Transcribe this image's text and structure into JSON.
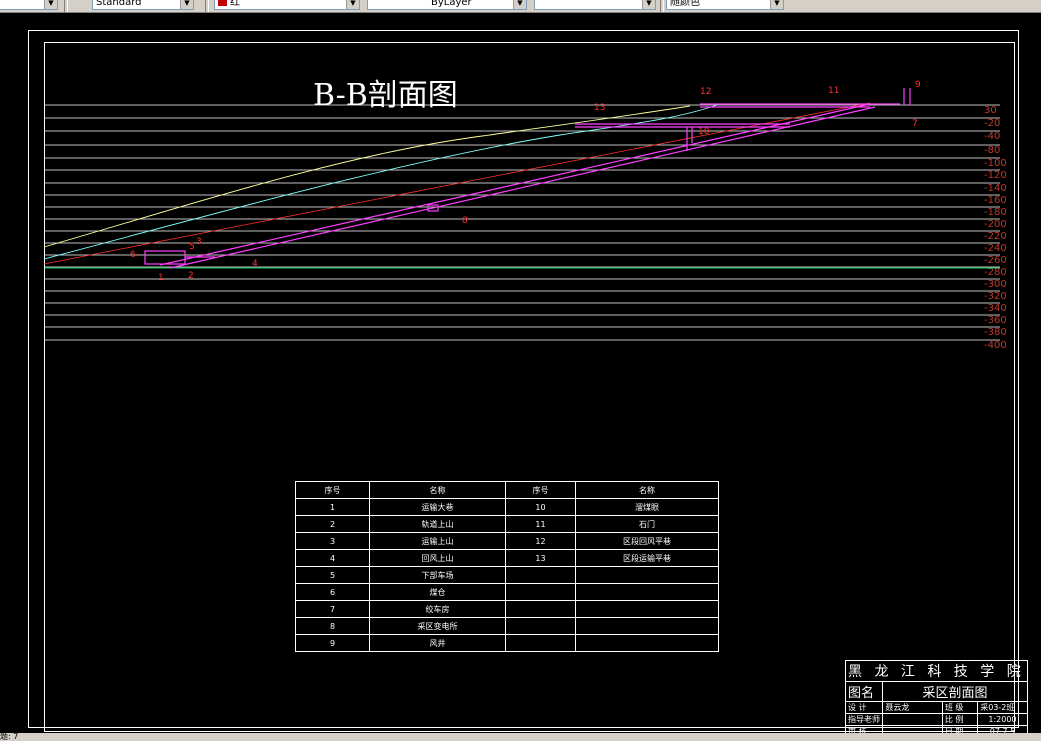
{
  "toolbar": {
    "text_style": "Standard",
    "color": "红",
    "linetype": "ByLayer",
    "lineweight": "",
    "plot_style": "随颜色"
  },
  "status": {
    "text": "题: 7"
  },
  "drawing": {
    "title": "B-B剖面图",
    "elevation_labels": [
      "30",
      "-20",
      "-40",
      "-80",
      "-100",
      "-120",
      "-140",
      "-160",
      "-180",
      "-200",
      "-220",
      "-240",
      "-260",
      "-280",
      "-300",
      "-320",
      "-340",
      "-360",
      "-380",
      "-400"
    ],
    "callouts": [
      "1",
      "2",
      "3",
      "4",
      "5",
      "6",
      "7",
      "8",
      "9",
      "10",
      "11",
      "12",
      "13"
    ]
  },
  "legend": {
    "headers": [
      "序号",
      "名称",
      "序号",
      "名称"
    ],
    "rows": [
      [
        "1",
        "运输大巷",
        "10",
        "溜煤眼"
      ],
      [
        "2",
        "轨道上山",
        "11",
        "石门"
      ],
      [
        "3",
        "运输上山",
        "12",
        "区段回风平巷"
      ],
      [
        "4",
        "回风上山",
        "13",
        "区段运输平巷"
      ],
      [
        "5",
        "下部车场",
        "",
        ""
      ],
      [
        "6",
        "煤仓",
        "",
        ""
      ],
      [
        "7",
        "绞车房",
        "",
        ""
      ],
      [
        "8",
        "采区变电所",
        "",
        ""
      ],
      [
        "9",
        "风井",
        "",
        ""
      ]
    ]
  },
  "title_block": {
    "school": "黑 龙 江 科 技 学 院",
    "drawing_name_label": "图名",
    "drawing_name": "采区剖面图",
    "design_label": "设 计",
    "designer": "聂云龙",
    "class_label": "班 级",
    "class_value": "采03-2班",
    "advisor_label": "指导老师",
    "advisor": "",
    "scale_label": "比 例",
    "scale_value": "1:2000",
    "review_label": "审 核",
    "reviewer": "",
    "date_label": "日 期",
    "date_value": "07.7.5"
  }
}
